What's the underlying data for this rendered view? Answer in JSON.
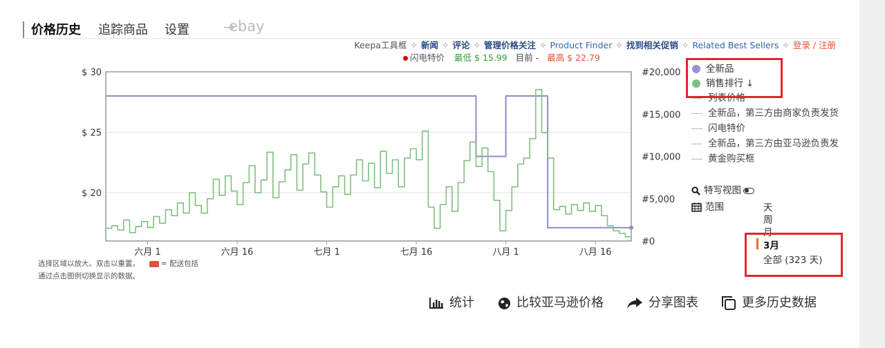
{
  "tabs": {
    "price_history": "价格历史",
    "tracking": "追踪商品",
    "settings": "设置",
    "arrow": "→",
    "ebay": "ebay"
  },
  "toolbar": {
    "keepa_box": "Keepa工具框",
    "news": "新闻",
    "reviews": "评论",
    "manage_tracking": "管理价格关注",
    "product_finder": "Product Finder",
    "find_deals": "找到相关促销",
    "related_best_sellers": "Related Best Sellers",
    "login": "登录 / 注册",
    "separator": "✧"
  },
  "summary": {
    "lightning_deal": "闪电特价",
    "lowest": "最低 $ 15.99",
    "current": "目前 -",
    "highest": "最高 $ 22.79"
  },
  "chart_data": {
    "type": "line",
    "title": "",
    "x_tick_labels": [
      "六月 1",
      "六月 16",
      "七月 1",
      "七月 16",
      "八月 1",
      "八月 16"
    ],
    "y_left_ticks": [
      "$ 30",
      "$ 25",
      "$ 20"
    ],
    "y_left_values": [
      30,
      25,
      20
    ],
    "y_right_ticks": [
      "#20,000",
      "#15,000",
      "#10,000",
      "#5,000",
      "#0"
    ],
    "y_right_values": [
      20000,
      15000,
      10000,
      5000,
      0
    ],
    "y_left_range": [
      16,
      30
    ],
    "y_right_range": [
      0,
      20000
    ],
    "x_range_days": [
      0,
      88
    ],
    "x_tick_days": [
      7,
      22,
      37,
      52,
      67,
      82
    ],
    "series": [
      {
        "name": "全新品",
        "axis": "left",
        "color": "#8c8cc8",
        "points": [
          [
            0,
            28.0
          ],
          [
            62,
            28.0
          ],
          [
            62,
            23.0
          ],
          [
            67,
            23.0
          ],
          [
            67,
            28.0
          ],
          [
            74,
            28.0
          ],
          [
            74,
            17.1
          ],
          [
            88,
            17.1
          ]
        ]
      },
      {
        "name": "销售排行",
        "axis": "right",
        "color": "#7fbf7f",
        "points": [
          [
            0,
            1500
          ],
          [
            1,
            1800
          ],
          [
            2,
            1300
          ],
          [
            3,
            2500
          ],
          [
            4,
            1000
          ],
          [
            5,
            1700
          ],
          [
            6,
            2300
          ],
          [
            7,
            1600
          ],
          [
            8,
            2900
          ],
          [
            9,
            2100
          ],
          [
            10,
            3700
          ],
          [
            11,
            3000
          ],
          [
            12,
            4500
          ],
          [
            13,
            3300
          ],
          [
            14,
            5700
          ],
          [
            15,
            4200
          ],
          [
            16,
            3300
          ],
          [
            17,
            5000
          ],
          [
            18,
            7300
          ],
          [
            19,
            5400
          ],
          [
            20,
            7700
          ],
          [
            21,
            5900
          ],
          [
            22,
            4300
          ],
          [
            23,
            6900
          ],
          [
            24,
            8900
          ],
          [
            25,
            5700
          ],
          [
            26,
            7200
          ],
          [
            27,
            10500
          ],
          [
            28,
            5100
          ],
          [
            29,
            7000
          ],
          [
            30,
            8400
          ],
          [
            31,
            10200
          ],
          [
            32,
            6000
          ],
          [
            33,
            9100
          ],
          [
            34,
            10400
          ],
          [
            35,
            7800
          ],
          [
            36,
            5800
          ],
          [
            37,
            4000
          ],
          [
            38,
            6400
          ],
          [
            39,
            7700
          ],
          [
            40,
            5500
          ],
          [
            41,
            7800
          ],
          [
            42,
            9600
          ],
          [
            43,
            7100
          ],
          [
            44,
            9200
          ],
          [
            45,
            6300
          ],
          [
            46,
            10600
          ],
          [
            47,
            8000
          ],
          [
            48,
            9600
          ],
          [
            49,
            6400
          ],
          [
            50,
            9800
          ],
          [
            51,
            10900
          ],
          [
            52,
            9600
          ],
          [
            53,
            13000
          ],
          [
            54,
            4000
          ],
          [
            55,
            1500
          ],
          [
            56,
            4300
          ],
          [
            57,
            6400
          ],
          [
            58,
            3500
          ],
          [
            59,
            6900
          ],
          [
            60,
            9500
          ],
          [
            61,
            11700
          ],
          [
            62,
            8800
          ],
          [
            63,
            11000
          ],
          [
            64,
            8200
          ],
          [
            65,
            4800
          ],
          [
            66,
            1200
          ],
          [
            67,
            3600
          ],
          [
            68,
            6400
          ],
          [
            69,
            9100
          ],
          [
            70,
            9800
          ],
          [
            71,
            12100
          ],
          [
            72,
            17900
          ],
          [
            73,
            12800
          ],
          [
            74,
            9800
          ],
          [
            75,
            3700
          ],
          [
            76,
            4100
          ],
          [
            77,
            3200
          ],
          [
            78,
            4300
          ],
          [
            79,
            3600
          ],
          [
            80,
            4500
          ],
          [
            81,
            3500
          ],
          [
            82,
            4200
          ],
          [
            83,
            3000
          ],
          [
            84,
            1800
          ],
          [
            85,
            1200
          ],
          [
            86,
            900
          ],
          [
            87,
            500
          ],
          [
            88,
            300
          ]
        ]
      }
    ],
    "grid": true
  },
  "legend": {
    "new": "全新品",
    "sales_rank": "销售排行",
    "sort_glyph": "↓",
    "list_price": "列表价格",
    "new_3p_fbm": "全新品，第三方由商家负责发货",
    "lightning": "闪电特价",
    "new_3p_fba": "全新品，第三方由亚马逊负责发",
    "buy_box": "黄金购买框",
    "new_color": "#9b8fd6",
    "sales_color": "#7fbf7f"
  },
  "controls": {
    "zoom_view": "特写视图",
    "range": "范围",
    "range_options": [
      "天",
      "周",
      "月",
      "3月",
      "全部 (323 天)"
    ],
    "range_selected": "3月"
  },
  "notes": {
    "line1": "选择区域以放大。双击以重置。",
    "shipping": "= 配送包括",
    "line2": "通过点击图例切换显示的数据。"
  },
  "actions": {
    "stats": "统计",
    "compare": "比较亚马逊价格",
    "share": "分享图表",
    "more_history": "更多历史数据"
  }
}
